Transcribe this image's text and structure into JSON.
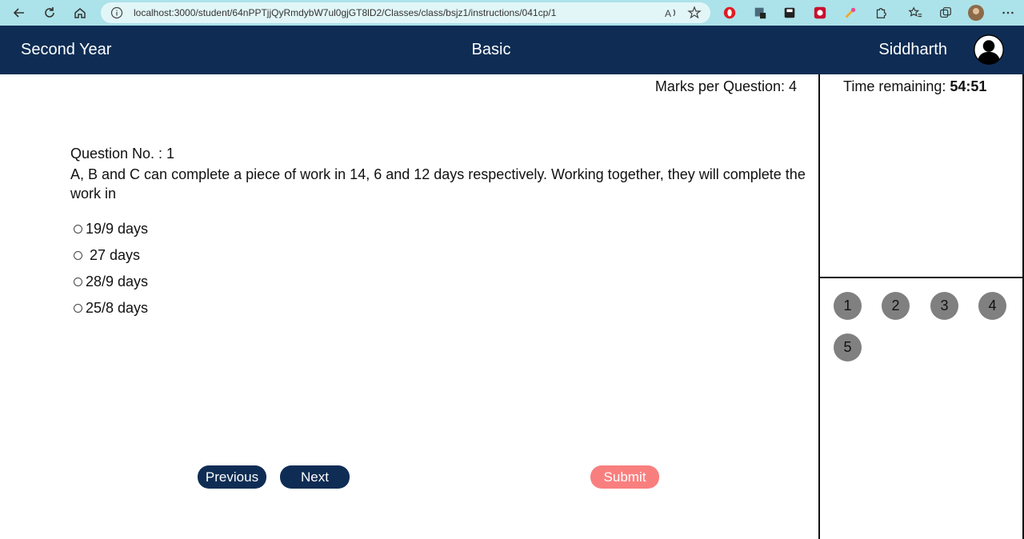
{
  "browser": {
    "url": "localhost:3000/student/64nPPTjjQyRmdybW7ul0gjGT8lD2/Classes/class/bsjz1/instructions/041cp/1"
  },
  "header": {
    "class_name": "Second Year",
    "test_name": "Basic",
    "user_name": "Siddharth"
  },
  "main": {
    "marks_per_question": "Marks per Question: 4",
    "question_no": "Question No. : 1",
    "question_text": "A, B and C can complete a piece of work in 14, 6 and 12 days respectively. Working together, they will complete the work in",
    "options": [
      "19/9 days",
      " 27 days",
      "28/9 days",
      "25/8 days"
    ],
    "buttons": {
      "previous": "Previous",
      "next": "Next",
      "submit": "Submit"
    }
  },
  "sidebar": {
    "timer_label": "Time remaining:",
    "timer_value": "54:51",
    "questions": [
      "1",
      "2",
      "3",
      "4",
      "5"
    ]
  },
  "colors": {
    "header_bg": "#0f2d54",
    "submit_bg": "#f97f7f",
    "question_bubble": "#808080"
  }
}
